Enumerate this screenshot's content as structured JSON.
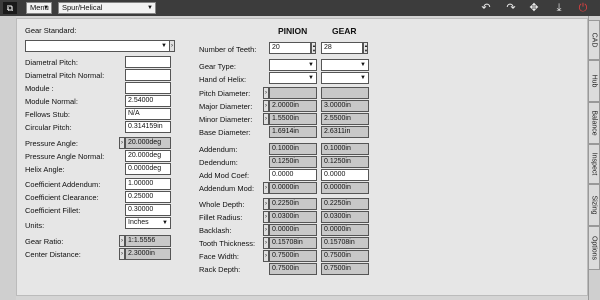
{
  "topbar": {
    "logo": "⧉",
    "menu": "Menu",
    "gear_type_select": "Spur/Helical",
    "icons": [
      "undo-icon",
      "redo-icon",
      "network-icon",
      "download-icon",
      "power-icon"
    ]
  },
  "right_tabs": [
    "CAD",
    "Hub",
    "Balance",
    "Inspect",
    "Sizing",
    "Options"
  ],
  "left": {
    "gear_standard_label": "Gear Standard:",
    "gear_standard_value": "",
    "rows": [
      {
        "label": "Diametral Pitch:",
        "value": ""
      },
      {
        "label": "Diametral Pitch Normal:",
        "value": ""
      },
      {
        "label": "Module :",
        "value": ""
      },
      {
        "label": "Module Normal:",
        "value": "2.54000"
      },
      {
        "label": "Fellows Stub:",
        "value": "N/A"
      },
      {
        "label": "Circular Pitch:",
        "value": "0.314159in"
      },
      {
        "label": "Pressure Angle:",
        "value": "20.000deg"
      },
      {
        "label": "Pressure Angle Normal:",
        "value": "20.000deg"
      },
      {
        "label": "Helix Angle:",
        "value": "0.0000deg"
      },
      {
        "label": "Coefficient Addendum:",
        "value": "1.00000"
      },
      {
        "label": "Coefficient Clearance:",
        "value": "0.25000"
      },
      {
        "label": "Coefficient Fillet:",
        "value": "0.30000"
      },
      {
        "label": "Units:",
        "value": "Inches"
      },
      {
        "label": "Gear Ratio:",
        "value": "1:1.5556"
      },
      {
        "label": "Center Distance:",
        "value": "2.3000in"
      }
    ]
  },
  "right": {
    "pinion_header": "PINION",
    "gear_header": "GEAR",
    "teeth": {
      "label": "Number of Teeth:",
      "pinion": "20",
      "gear": "28"
    },
    "gear_type": {
      "label": "Gear Type:",
      "pinion": "",
      "gear": ""
    },
    "hand": {
      "label": "Hand of Helix:",
      "pinion": "",
      "gear": ""
    },
    "rows": [
      {
        "label": "Pitch Diameter:",
        "pinion": "",
        "gear": ""
      },
      {
        "label": "Major Diameter:",
        "pinion": "2.0000in",
        "gear": "3.0000in"
      },
      {
        "label": "Minor Diameter:",
        "pinion": "1.5500in",
        "gear": "2.5500in"
      },
      {
        "label": "Base Diameter:",
        "pinion": "1.6914in",
        "gear": "2.6311in"
      },
      {
        "label": "Addendum:",
        "pinion": "0.1000in",
        "gear": "0.1000in"
      },
      {
        "label": "Dedendum:",
        "pinion": "0.1250in",
        "gear": "0.1250in"
      },
      {
        "label": "Add Mod Coef:",
        "pinion": "0.0000",
        "gear": "0.0000"
      },
      {
        "label": "Addendum Mod:",
        "pinion": "0.0000in",
        "gear": "0.0000in"
      },
      {
        "label": "Whole Depth:",
        "pinion": "0.2250in",
        "gear": "0.2250in"
      },
      {
        "label": "Fillet Radius:",
        "pinion": "0.0300in",
        "gear": "0.0300in"
      },
      {
        "label": "Backlash:",
        "pinion": "0.0000in",
        "gear": "0.0000in"
      },
      {
        "label": "Tooth Thickness:",
        "pinion": "0.15708in",
        "gear": "0.15708in"
      },
      {
        "label": "Face Width:",
        "pinion": "0.7500in",
        "gear": "0.7500in"
      },
      {
        "label": "Rack Depth:",
        "pinion": "0.7500in",
        "gear": "0.7500in"
      }
    ]
  }
}
